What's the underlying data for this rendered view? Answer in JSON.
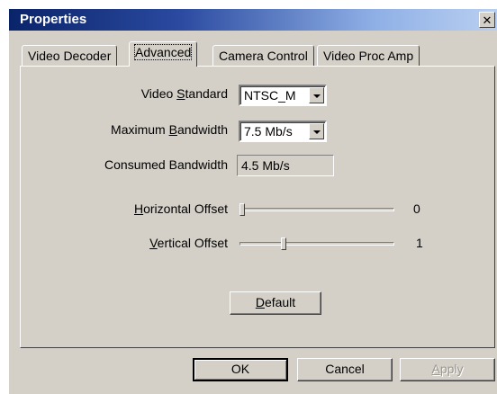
{
  "window": {
    "title": "Properties",
    "close_icon": "close-icon"
  },
  "tabs": [
    {
      "label": "Video Decoder",
      "active": false
    },
    {
      "label": "Advanced",
      "active": true
    },
    {
      "label": "Camera Control",
      "active": false
    },
    {
      "label": "Video Proc Amp",
      "active": false
    }
  ],
  "fields": {
    "video_standard": {
      "label_pre": "Video ",
      "label_u": "S",
      "label_post": "tandard",
      "value": "NTSC_M"
    },
    "max_bandwidth": {
      "label_pre": "Maximum ",
      "label_u": "B",
      "label_post": "andwidth",
      "value": "7.5 Mb/s"
    },
    "consumed_bandwidth": {
      "label": "Consumed Bandwidth",
      "value": "4.5 Mb/s"
    }
  },
  "sliders": {
    "horizontal_offset": {
      "label_u": "H",
      "label_post": "orizontal Offset",
      "value": "0",
      "position": 0.0
    },
    "vertical_offset": {
      "label_u": "V",
      "label_post": "ertical Offset",
      "value": "1",
      "position": 0.28
    }
  },
  "buttons": {
    "default": {
      "label_u": "D",
      "label_post": "efault"
    },
    "ok": {
      "label": "OK"
    },
    "cancel": {
      "label": "Cancel"
    },
    "apply": {
      "label_u": "A",
      "label_post": "pply",
      "enabled": false
    }
  },
  "colors": {
    "titlebar": "#0a246a",
    "face": "#d4d0c8"
  }
}
